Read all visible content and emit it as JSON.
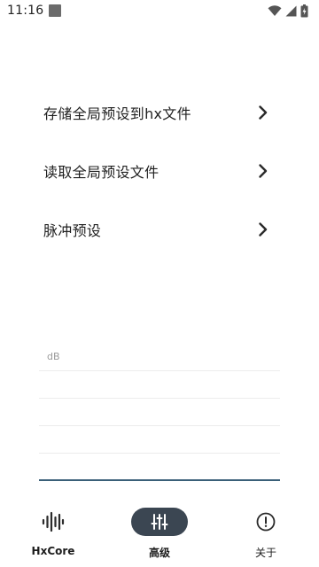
{
  "status_bar": {
    "time": "11:16",
    "icons": [
      "notification-square-icon",
      "wifi-icon",
      "cell-signal-icon",
      "battery-icon"
    ]
  },
  "menu": {
    "items": [
      {
        "label": "存储全局预设到hx文件",
        "icon": "chevron-right-icon"
      },
      {
        "label": "读取全局预设文件",
        "icon": "chevron-right-icon"
      },
      {
        "label": "脉冲预设",
        "icon": "chevron-right-icon"
      }
    ]
  },
  "chart": {
    "unit_label": "dB",
    "line_color": "#3a5f78",
    "grid_color": "#ececec"
  },
  "bottom_nav": {
    "items": [
      {
        "label": "HxCore",
        "icon": "waveform-icon",
        "active": false
      },
      {
        "label": "高级",
        "icon": "sliders-icon",
        "active": true
      },
      {
        "label": "关于",
        "icon": "info-circle-icon",
        "active": false
      }
    ],
    "active_color": "#3b4652"
  }
}
